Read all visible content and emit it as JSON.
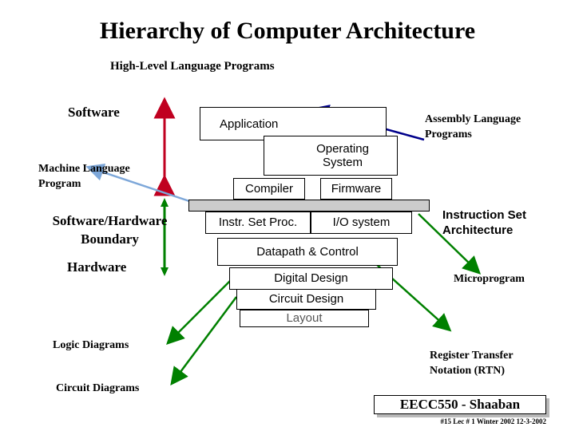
{
  "title": "Hierarchy of Computer Architecture",
  "labels": {
    "high_level": "High-Level Language Programs",
    "software": "Software",
    "machine_language": "Machine Language\nProgram",
    "sw_hw_boundary": "Software/Hardware\nBoundary",
    "hardware": "Hardware",
    "assembly": "Assembly Language\nPrograms",
    "isa": "Instruction Set\nArchitecture",
    "microprogram": "Microprogram",
    "rtn": "Register Transfer\nNotation (RTN)",
    "logic_diagrams": "Logic Diagrams",
    "circuit_diagrams": "Circuit Diagrams"
  },
  "boxes": {
    "application": "Application",
    "operating_system": "Operating\nSystem",
    "compiler": "Compiler",
    "firmware": "Firmware",
    "instr_set_proc": "Instr. Set Proc.",
    "io_system": "I/O system",
    "datapath_control": "Datapath & Control",
    "digital_design": "Digital Design",
    "circuit_design": "Circuit Design",
    "layout": "Layout"
  },
  "footer": {
    "course": "EECC550 - Shaaban",
    "note": "#15  Lec # 1 Winter 2002  12-3-2002"
  },
  "colors": {
    "red_arrow": "#c00020",
    "green_arrow": "#008000",
    "blue_arrow": "#00008b",
    "light_blue_arrow": "#7da7d9",
    "bar_fill": "#cccccc"
  }
}
